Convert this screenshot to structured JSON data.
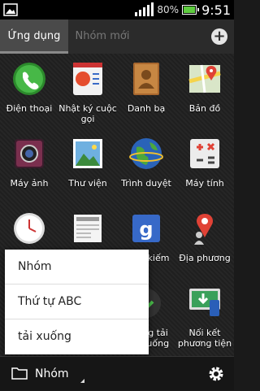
{
  "status": {
    "battery_pct": "80%",
    "time": "9:51"
  },
  "tabs": [
    {
      "label": "Ứng dụng",
      "active": true
    },
    {
      "label": "Nhóm mới",
      "active": false
    }
  ],
  "apps": [
    {
      "label": "Điện thoại",
      "icon": "phone-icon"
    },
    {
      "label": "Nhật ký cuộc gọi",
      "icon": "call-log-icon"
    },
    {
      "label": "Danh bạ",
      "icon": "contacts-icon"
    },
    {
      "label": "Bản đồ",
      "icon": "maps-icon"
    },
    {
      "label": "Máy ảnh",
      "icon": "camera-icon"
    },
    {
      "label": "Thư viện",
      "icon": "gallery-icon"
    },
    {
      "label": "Trình duyệt",
      "icon": "browser-icon"
    },
    {
      "label": "Máy tính",
      "icon": "calculator-icon"
    },
    {
      "label": "",
      "icon": "clock-icon"
    },
    {
      "label": "",
      "icon": "news-icon"
    },
    {
      "label": "kiếm",
      "icon": "google-search-icon"
    },
    {
      "label": "Địa phương",
      "icon": "local-icon"
    },
    {
      "label": "ng tải xuống",
      "icon": "download-icon"
    },
    {
      "label": "Nối kết phương tiện",
      "icon": "media-connect-icon"
    }
  ],
  "popup_menu": {
    "items": [
      "Nhóm",
      "Thứ tự ABC",
      "tải xuống"
    ]
  },
  "bottom_bar": {
    "group_label": "Nhóm"
  },
  "colors": {
    "battery": "#5ecb3f",
    "tab_active_bg": "#4a4a4a"
  }
}
